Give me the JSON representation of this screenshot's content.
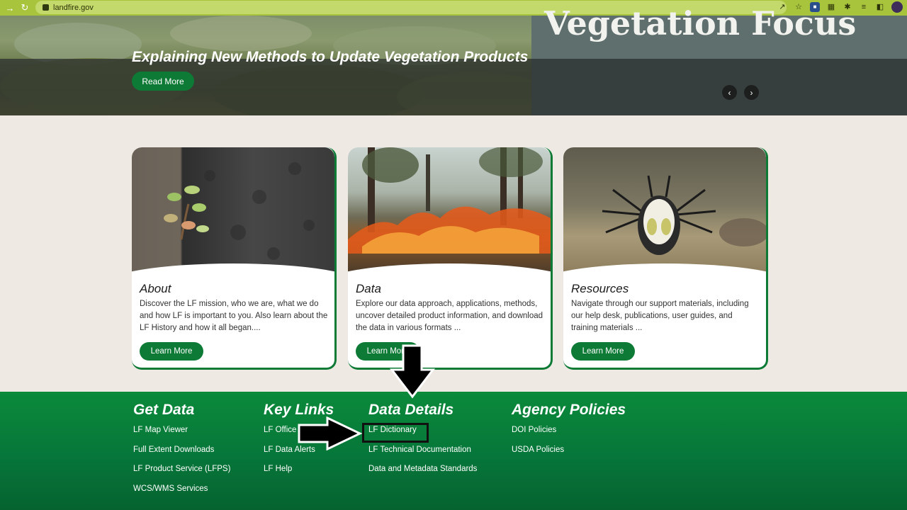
{
  "browser": {
    "url": "landfire.gov"
  },
  "hero": {
    "background_heading": "Vegetation Focus",
    "title": "Explaining New Methods to Update Vegetation Products",
    "button_label": "Read More",
    "prev_icon": "chevron-left",
    "next_icon": "chevron-right"
  },
  "cards": [
    {
      "title": "About",
      "description": "Discover the LF mission, who we are, what we do and how LF is important to you. Also learn about the LF History and how it all began....",
      "button_label": "Learn More"
    },
    {
      "title": "Data",
      "description": "Explore our data approach, applications, methods, uncover detailed product information, and download the data in various formats ...",
      "button_label": "Learn More"
    },
    {
      "title": "Resources",
      "description": "Navigate through our support materials, including our help desk, publications, user guides, and training materials ...",
      "button_label": "Learn More"
    }
  ],
  "footer": {
    "get_data": {
      "heading": "Get Data",
      "links": [
        "LF Map Viewer",
        "Full Extent Downloads",
        "LF Product Service (LFPS)",
        "WCS/WMS Services"
      ]
    },
    "key_links": {
      "heading": "Key Links",
      "links": [
        "LF Office H",
        "LF Data Alerts",
        "LF Help"
      ]
    },
    "data_details": {
      "heading": "Data Details",
      "links": [
        "LF Dictionary",
        "LF Technical Documentation",
        "Data and Metadata Standards"
      ]
    },
    "agency_policies": {
      "heading": "Agency Policies",
      "links": [
        "DOI Policies",
        "USDA Policies"
      ]
    }
  },
  "colors": {
    "accent": "#0d7a36",
    "browser_bar": "#a8c43d",
    "page_bg": "#eeeae3"
  }
}
